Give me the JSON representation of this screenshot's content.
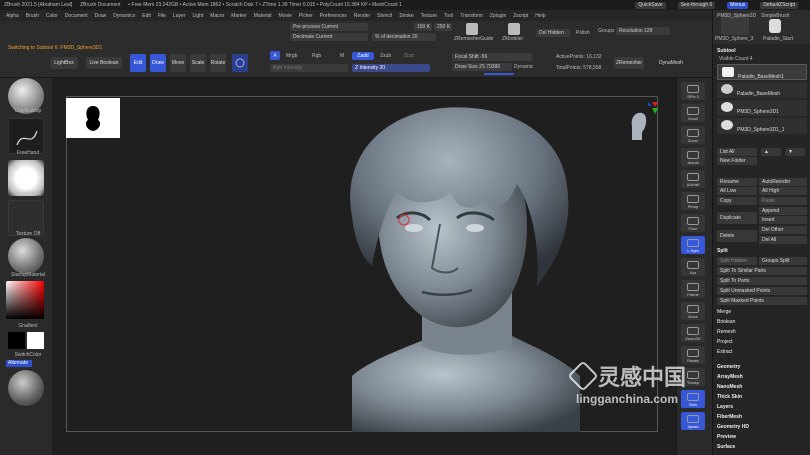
{
  "titlebar": {
    "items": [
      "ZBrush 2021.5 [Abraham Leal]",
      "ZBrush Document",
      "• Free Mem 23.242GB • Active Mem 1862 • Scratch Disk 7 • ZTime 1.39 Timer 0.015 • PolyCount 16.384 KP • MeshCount 1"
    ],
    "quicksave": "QuickSave",
    "seethrough": "See-through 0",
    "menus": "Menus",
    "script": "DefaultZScript"
  },
  "menubar": [
    "Alpha",
    "Brush",
    "Color",
    "Document",
    "Draw",
    "Dynamics",
    "Edit",
    "File",
    "Layer",
    "Light",
    "Macro",
    "Marker",
    "Material",
    "Movie",
    "Picker",
    "Preferences",
    "Render",
    "Stencil",
    "Stroke",
    "Texture",
    "Tool",
    "Transform",
    "Zplugin",
    "Zscript",
    "Help"
  ],
  "toolbar": {
    "notice": "Switching to Subtool 6: PM3D_Sphere3D1",
    "lightbox": "LightBox",
    "live_boolean": "Live Boolean",
    "edit": "Edit",
    "draw": "Draw",
    "move": "Move",
    "scale": "Scale",
    "rotate": "Rotate",
    "mrgb": "Mrgb",
    "rgb": "Rgb",
    "m": "M",
    "zadd": "Zadd",
    "zsub": "Zsub",
    "zcut": "Zcut",
    "rgb_intensity": "Rgb Intensity",
    "z_intensity": "Z Intensity 20",
    "preprocess": "Pre-process Current",
    "decimate": "Decimate Current",
    "pct_decimation": "% of decimation 20",
    "k150": "150 K",
    "k250": "250 K",
    "zremesher_guide": "ZRemesherGuide",
    "zmodeler": "ZModeler",
    "del_hidden": "Del Hidden",
    "polish": "Polish",
    "groups": "Groups",
    "resolution": "Resolution 128",
    "focal_shift": "Focal Shift -56",
    "draw_size": "Draw Size 25.70386",
    "dynamic": "Dynamic",
    "active_points": "ActivePoints: 16,132",
    "total_points": "TotalPoints: 578,558",
    "zremesher": "ZRemesher",
    "dynamesh": "DynaMesh"
  },
  "leftshelf": {
    "brush": "ClayBuildup",
    "stroke": "FreeHand",
    "alpha": "BrushAlpha",
    "texture": "Texture Off",
    "material": "StartupMaterial",
    "gradient": "Gradient",
    "switchcolor": "SwitchColor",
    "alternate": "Alternate"
  },
  "rightshelf": [
    "SPix 3",
    "Scroll",
    "Zoom",
    "Actual",
    "AAHalf",
    "Persp",
    "Floor",
    "L.Sym",
    "Xyz",
    "Frame",
    "Move",
    "Zoom3D",
    "Rotate",
    "Transp",
    "Solo",
    "Xpose"
  ],
  "tray": {
    "tools": [
      "PM3D_Sphere3D",
      "SimpleBrush",
      "PM3D_Sphere_3",
      "Paladin_Start"
    ],
    "subtool_title": "Subtool",
    "visible_count": "Visible Count 4",
    "subtools": [
      "Paladin_BaseMesh1",
      "Paladin_BaseMesh",
      "PM3D_Sphere3D1",
      "PM3D_Sphere3D1_1"
    ],
    "list_all": "List All",
    "new_folder": "New Folder",
    "rename": "Rename",
    "auto_reorder": "AutoReorder",
    "all_low": "All Low",
    "all_high": "All High",
    "copy": "Copy",
    "paste": "Paste",
    "append": "Append",
    "duplicate": "Duplicate",
    "insert": "Insert",
    "del_other": "Del Other",
    "delete": "Delete",
    "del_all": "Del All",
    "split": "Split",
    "split_hidden": "Split Hidden",
    "groups_split": "Groups Split",
    "split_similar": "Split To Similar Parts",
    "split_parts": "Split To Parts",
    "split_unmasked": "Split Unmasked Points",
    "split_masked": "Split Masked Points",
    "merge": "Merge",
    "boolean": "Boolean",
    "remesh": "Remesh",
    "project": "Project",
    "extract": "Extract",
    "geometry": "Geometry",
    "arraymesh": "ArrayMesh",
    "nanomesh": "NanoMesh",
    "thick_skin": "Thick Skin",
    "layers": "Layers",
    "fibermesh": "FiberMesh",
    "geometry_hd": "Geometry HD",
    "preview": "Preview",
    "surface": "Surface"
  },
  "watermark": {
    "cn": "灵感中国",
    "url": "lingganchina.com"
  }
}
